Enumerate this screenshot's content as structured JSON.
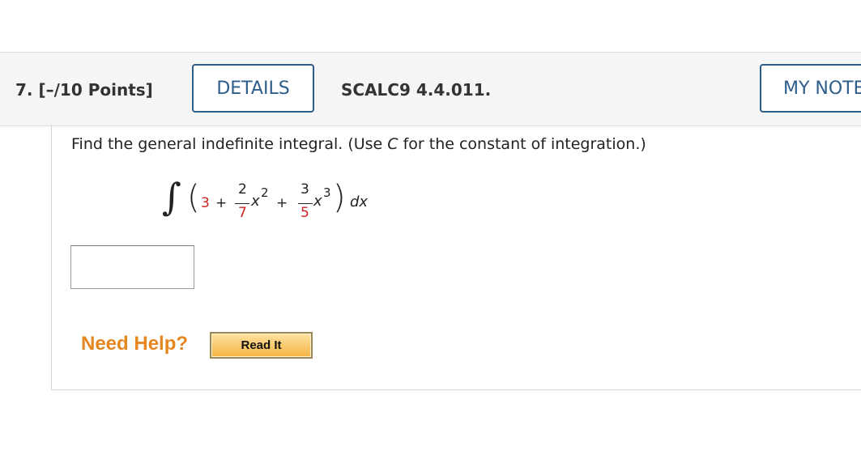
{
  "question": {
    "number_points": "7. [–/10 Points]",
    "details_label": "DETAILS",
    "reference": "SCALC9 4.4.011.",
    "my_notes_label": "MY NOTES"
  },
  "problem": {
    "prompt_before": "Find the general indefinite integral. (Use ",
    "prompt_var": "C",
    "prompt_after": " for the constant of integration.)",
    "integrand": {
      "integral_sign": "∫",
      "open_paren": "(",
      "close_paren": ")",
      "const_term": "3",
      "plus1": "+",
      "frac1_num": "2",
      "frac1_den": "7",
      "var1": "x",
      "exp1": "2",
      "plus2": "+",
      "frac2_num": "3",
      "frac2_den": "5",
      "var2": "x",
      "exp2": "3",
      "dx": "dx"
    },
    "answer_value": ""
  },
  "help": {
    "label": "Need Help?",
    "read_it_label": "Read It"
  },
  "colors": {
    "accent": "#2d5d8a",
    "highlight_red": "#cc2222",
    "help_orange": "#e5861f",
    "header_bg": "#f5f5f5"
  }
}
